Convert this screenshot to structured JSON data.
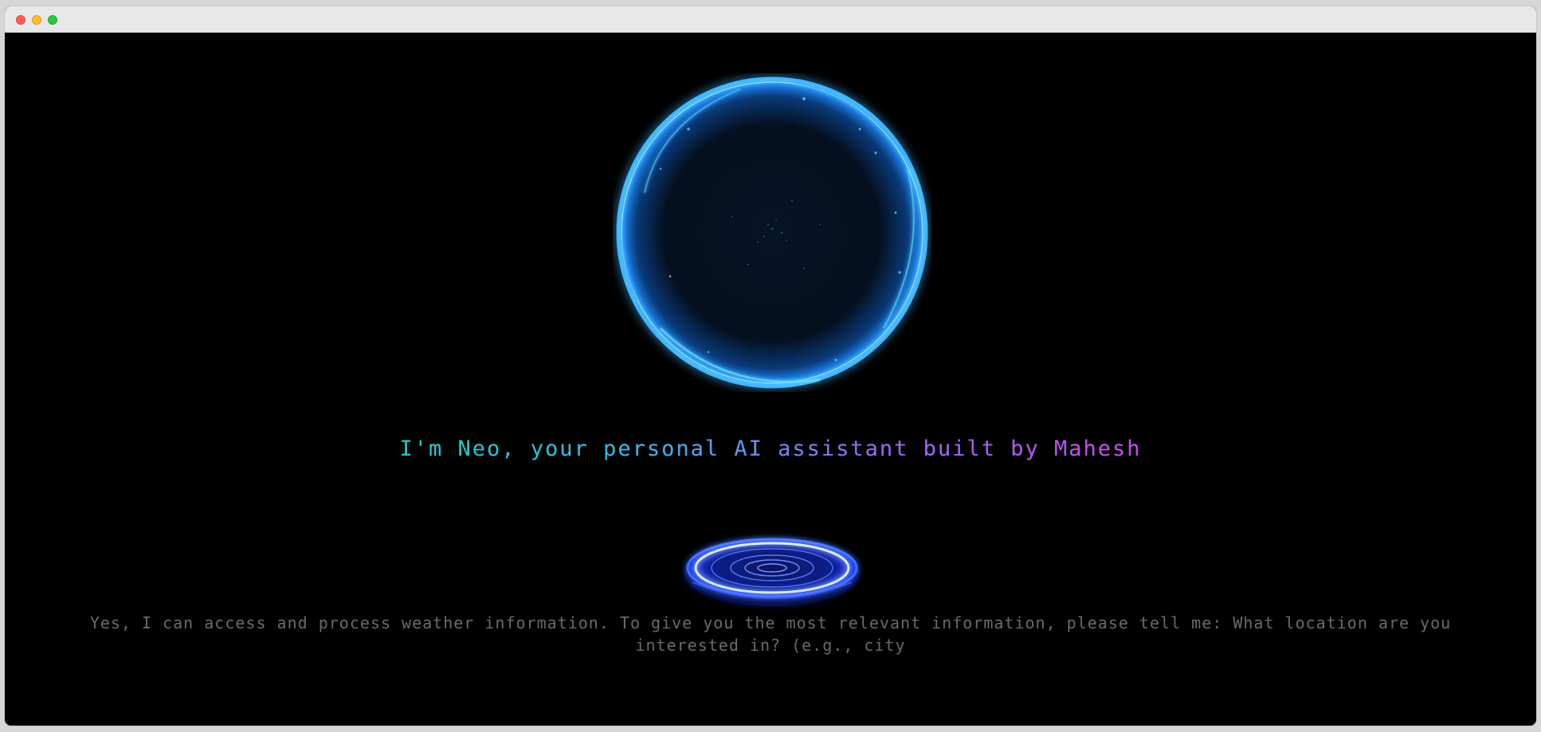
{
  "window": {
    "controls": [
      "close",
      "minimize",
      "maximize"
    ]
  },
  "colors": {
    "background": "#000000",
    "orb_primary": "#1e90ff",
    "orb_rim": "#5fd6ff",
    "headline_start": "#27c8c4",
    "headline_end": "#c946e0",
    "response_text": "#6a6a6a",
    "mic_ring": "#3a5cff"
  },
  "assistant": {
    "greeting_parts": [
      "I'm Neo, your personal AI assistant built by Mahesh"
    ],
    "response": "Yes, I can access and process weather information. To give you the most relevant information, please tell me: What location are you interested in? (e.g., city"
  },
  "icons": {
    "orb": "glowing-sphere-icon",
    "mic": "voice-ring-icon"
  }
}
